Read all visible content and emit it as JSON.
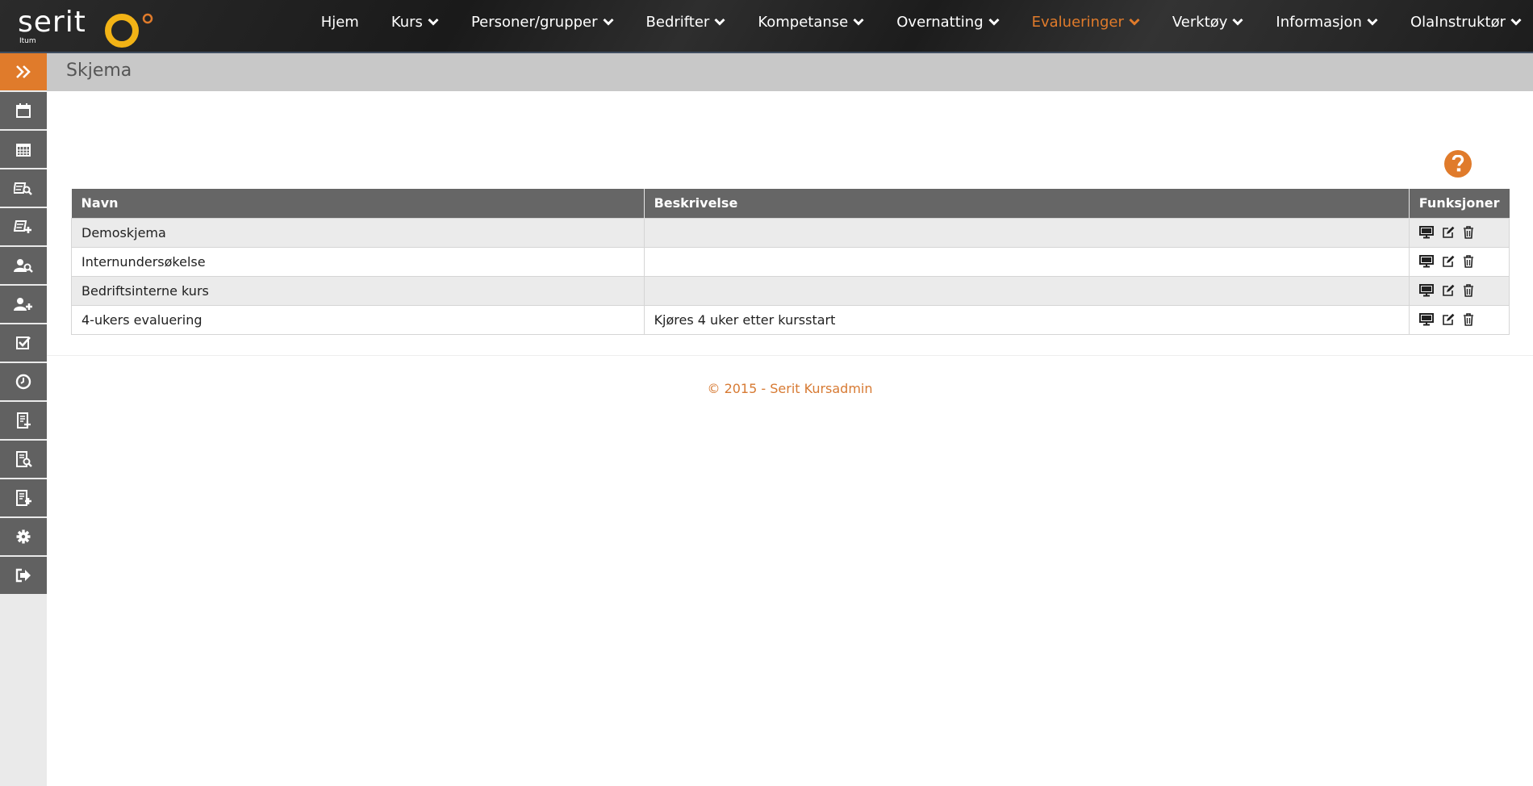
{
  "brand": {
    "name": "serit",
    "sub": "Itum"
  },
  "nav": {
    "items": [
      {
        "label": "Hjem",
        "dropdown": false
      },
      {
        "label": "Kurs",
        "dropdown": true
      },
      {
        "label": "Personer/grupper",
        "dropdown": true
      },
      {
        "label": "Bedrifter",
        "dropdown": true
      },
      {
        "label": "Kompetanse",
        "dropdown": true
      },
      {
        "label": "Overnatting",
        "dropdown": true
      },
      {
        "label": "Evalueringer",
        "dropdown": true,
        "active": true
      },
      {
        "label": "Verktøy",
        "dropdown": true
      },
      {
        "label": "Informasjon",
        "dropdown": true
      },
      {
        "label": "OlaInstruktør",
        "dropdown": true
      }
    ]
  },
  "sidebar": {
    "items": [
      "expand-icon",
      "calendar-icon",
      "calendar-grid-icon",
      "search-course-icon",
      "add-course-icon",
      "search-user-icon",
      "add-user-icon",
      "checkbox-icon",
      "clock-icon",
      "report-icon",
      "search-report-icon",
      "add-report-icon",
      "gear-icon",
      "logout-icon"
    ]
  },
  "page": {
    "title": "Skjema"
  },
  "table": {
    "headers": {
      "navn": "Navn",
      "beskrivelse": "Beskrivelse",
      "funksjoner": "Funksjoner"
    },
    "rows": [
      {
        "navn": "Demoskjema",
        "beskrivelse": ""
      },
      {
        "navn": "Internundersøkelse",
        "beskrivelse": ""
      },
      {
        "navn": "Bedriftsinterne kurs",
        "beskrivelse": ""
      },
      {
        "navn": "4-ukers evaluering",
        "beskrivelse": "Kjøres 4 uker etter kursstart"
      }
    ]
  },
  "footer": {
    "text": "© 2015 - Serit Kursadmin"
  },
  "colors": {
    "accent": "#e07b2b",
    "sidebar": "#616161",
    "table_header": "#666666"
  }
}
